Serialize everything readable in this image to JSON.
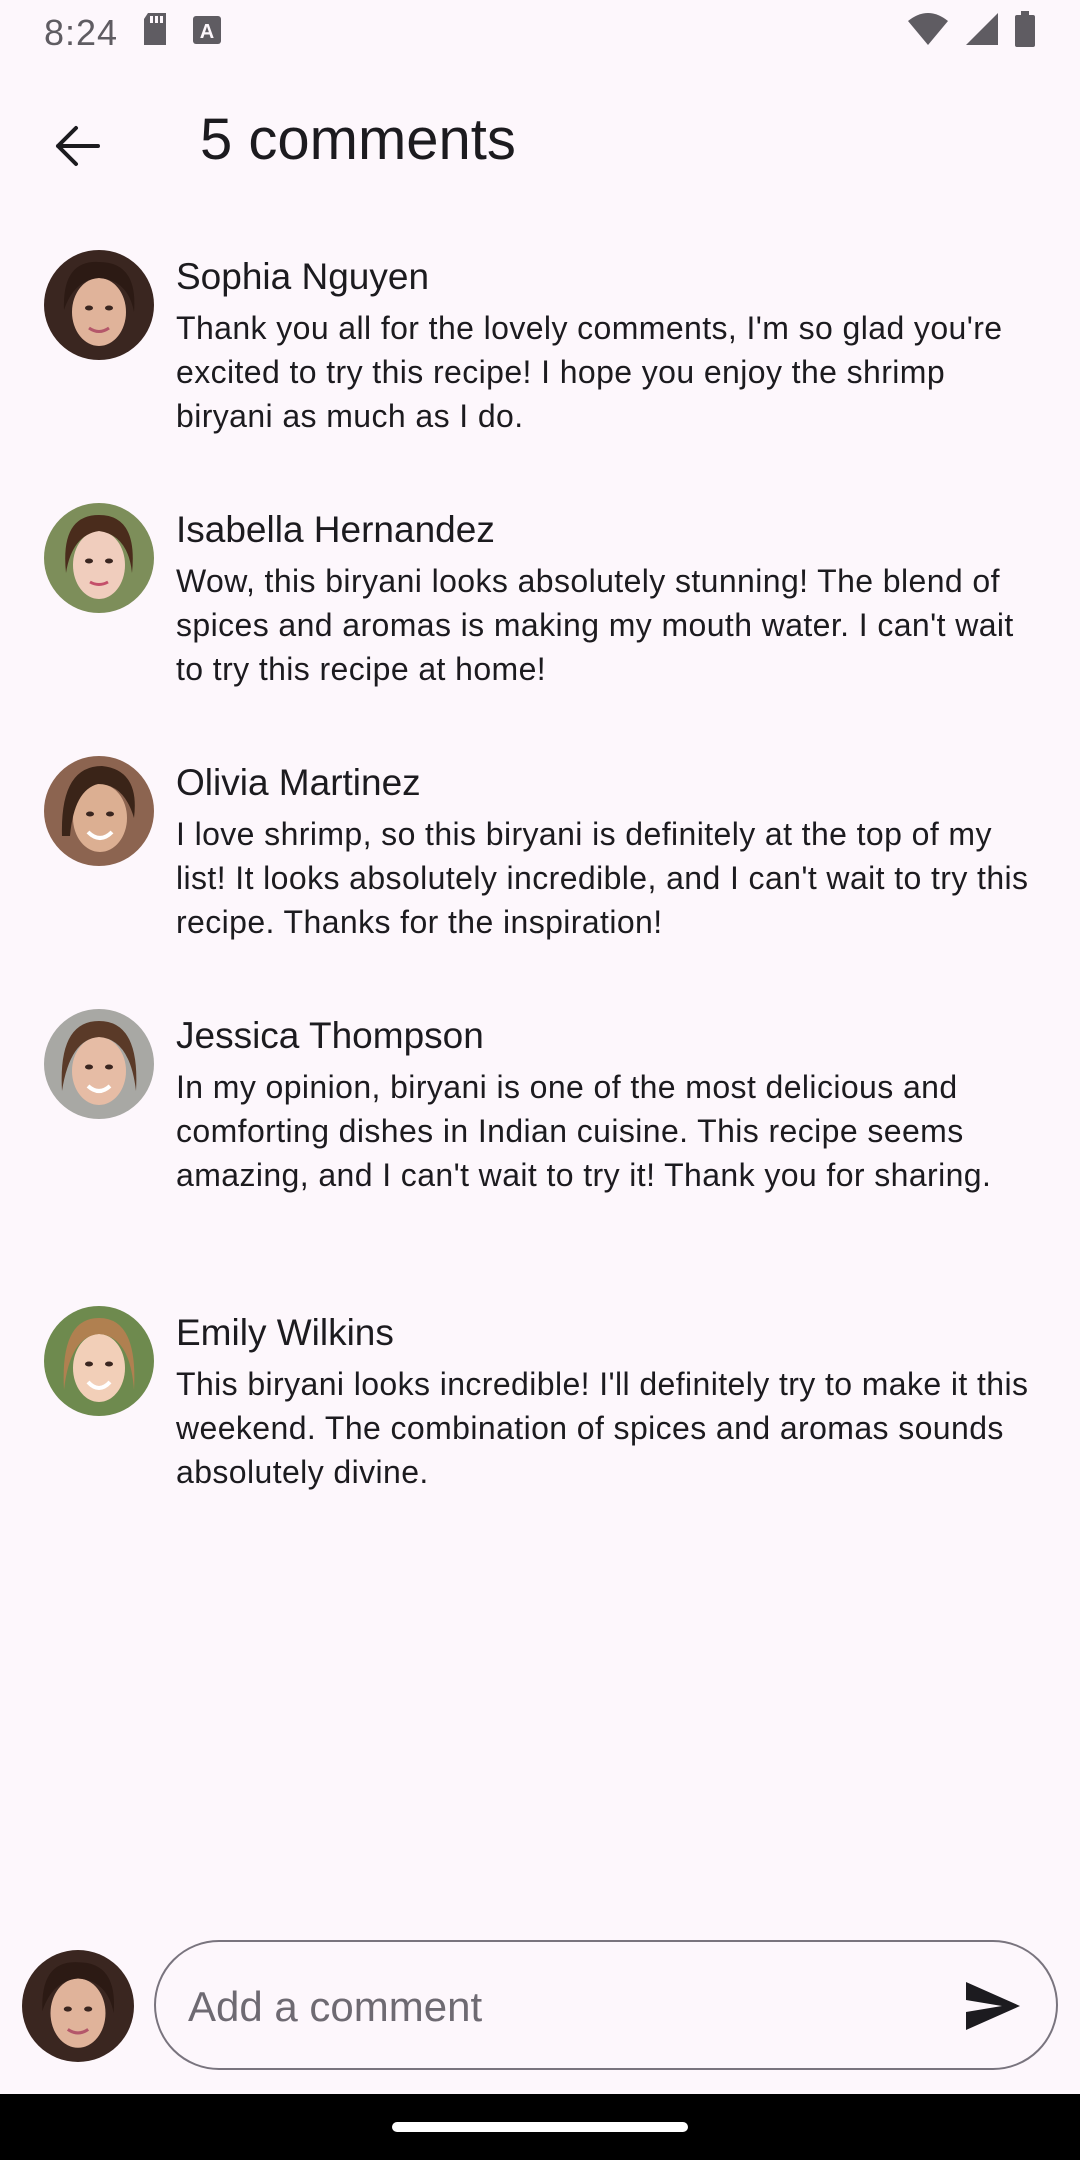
{
  "status_bar": {
    "time": "8:24",
    "icons": [
      "sd-card-icon",
      "text-a-icon",
      "wifi-icon",
      "signal-icon",
      "battery-icon"
    ]
  },
  "app_bar": {
    "title": "5 comments",
    "back_icon": "arrow-back-icon"
  },
  "comments": [
    {
      "name": "Sophia Nguyen",
      "text": "Thank you all for the lovely comments, I'm so glad you're excited to try this recipe! I hope you enjoy the shrimp biryani as much as I do."
    },
    {
      "name": "Isabella Hernandez",
      "text": "Wow, this biryani looks absolutely stunning! The blend of spices and aromas is making my mouth water. I can't wait to try this recipe at home!"
    },
    {
      "name": "Olivia Martinez",
      "text": "I love shrimp, so this biryani is definitely at the top of my list! It looks absolutely incredible, and I can't wait to try this recipe. Thanks for the inspiration!"
    },
    {
      "name": "Jessica Thompson",
      "text": "In my opinion, biryani is one of the most delicious and comforting dishes in Indian cuisine. This recipe seems amazing, and I can't wait to try it! Thank you for sharing."
    },
    {
      "name": "Emily Wilkins",
      "text": "This biryani looks incredible! I'll definitely try to make it this weekend. The combination of spices and aromas sounds absolutely divine."
    }
  ],
  "composer": {
    "placeholder": "Add a comment",
    "value": "",
    "send_icon": "send-icon"
  },
  "colors": {
    "background": "#fdf7fc",
    "text": "#1c1b1f",
    "outline": "#79747e"
  }
}
